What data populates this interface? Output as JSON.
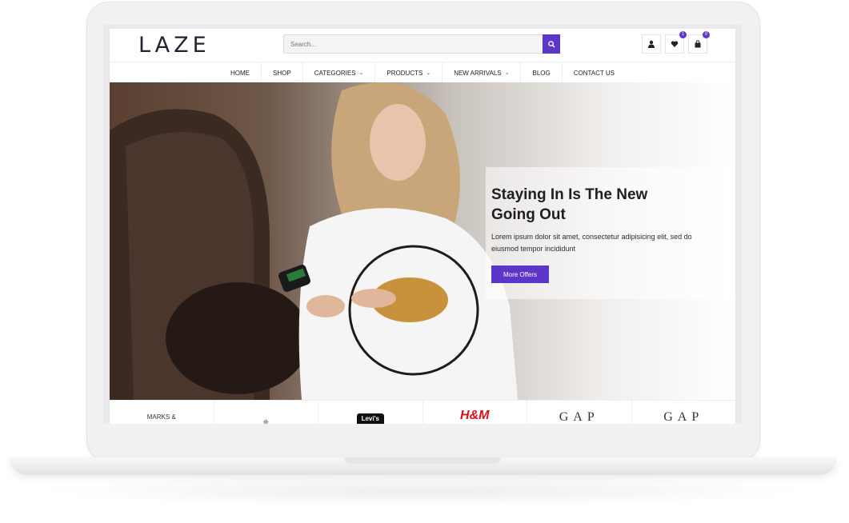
{
  "header": {
    "logo": "LAZE",
    "search_placeholder": "Search...",
    "wishlist_count": "1",
    "cart_count": "0"
  },
  "nav": {
    "items": [
      {
        "label": "HOME"
      },
      {
        "label": "SHOP"
      },
      {
        "label": "CATEGORIES"
      },
      {
        "label": "PRODUCTS"
      },
      {
        "label": "NEW ARRIVALS"
      },
      {
        "label": "BLOG"
      },
      {
        "label": "CONTACT US"
      }
    ]
  },
  "hero": {
    "title": "Staying In Is The New Going Out",
    "description": "Lorem ipsum dolor sit amet, consectetur adipisicing elit, sed do eiusmod tempor incididunt",
    "button": "More Offers"
  },
  "brands": {
    "marks": "MARKS &",
    "levis": "Levi's",
    "hm": "H&M",
    "gap1": "GAP",
    "gap2": "GAP"
  },
  "colors": {
    "accent": "#5b36c8",
    "logo": "#1e2233"
  }
}
